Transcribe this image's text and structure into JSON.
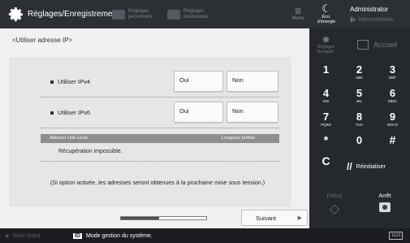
{
  "header": {
    "title": "Réglages/Enregistrement",
    "toolbar_items": [
      "Réglages personnels",
      "Réglages destinataire"
    ],
    "menu_label": "Menu"
  },
  "content": {
    "breadcrumb": "<Utiliser adresse IP>",
    "ipv4": {
      "label": "Utiliser IPv4",
      "yes": "Oui",
      "no": "Non"
    },
    "ipv6": {
      "label": "Utiliser IPv6",
      "yes": "Oui",
      "no": "Non"
    },
    "table": {
      "col_left": "Adresse Link-Local",
      "col_right": "Longueur préfixe",
      "value": "Récupération impossible."
    },
    "note": "(Si option activée, les adresses seront obtenues à la prochaine mise sous tension.)"
  },
  "bottom": {
    "progress": 0.45,
    "next_label": "Suivant",
    "next_arrow": "▶"
  },
  "statusbar": {
    "suivi": "Suivi statut",
    "badge": "ID",
    "message": "Mode gestion du système.",
    "battery": "1123"
  },
  "right_panel": {
    "eco_label": "Éco. d'énergie",
    "admin": "Administrator",
    "logout": "Déconnexion",
    "settings_label": "Réglages Enregistr.",
    "home_label": "Accueil",
    "keys": [
      {
        "n": "1",
        "s": ""
      },
      {
        "n": "2",
        "s": "ABC"
      },
      {
        "n": "3",
        "s": "DEF"
      },
      {
        "n": "4",
        "s": "GHI"
      },
      {
        "n": "5",
        "s": "JKL"
      },
      {
        "n": "6",
        "s": "MNO"
      },
      {
        "n": "7",
        "s": "PQRS"
      },
      {
        "n": "8",
        "s": "TUV"
      },
      {
        "n": "9",
        "s": "WXYZ"
      },
      {
        "n": "*",
        "s": ""
      },
      {
        "n": "0",
        "s": ""
      },
      {
        "n": "#",
        "s": ""
      }
    ],
    "clear_key": "C",
    "reset_label": "Réinitialiser",
    "start_label": "Début",
    "stop_label": "Arrêt"
  },
  "colors": {
    "dark_bg": "#1f2226",
    "header_bg": "#2c3035",
    "panel_bg": "#f1f1f1",
    "table_header": "#8e8e8e"
  }
}
